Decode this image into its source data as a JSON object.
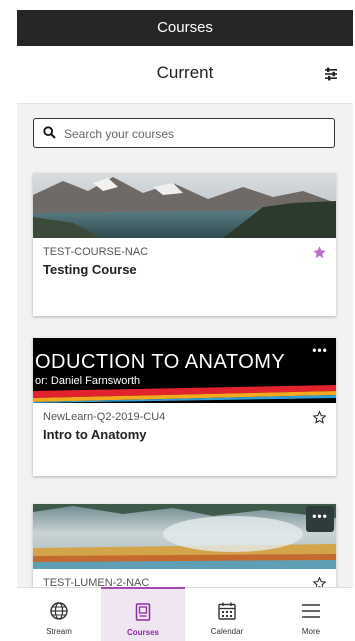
{
  "header": {
    "title": "Courses"
  },
  "subheader": {
    "title": "Current"
  },
  "search": {
    "placeholder": "Search your courses"
  },
  "courses": [
    {
      "id": "TEST-COURSE-NAC",
      "name": "Testing Course",
      "favorite": true
    },
    {
      "id": "NewLearn-Q2-2019-CU4",
      "name": "Intro to Anatomy",
      "favorite": false,
      "banner_title": "ODUCTION TO ANATOMY",
      "banner_subtitle": "or: Daniel Farnsworth"
    },
    {
      "id": "TEST-LUMEN-2-NAC",
      "name": "",
      "favorite": false
    }
  ],
  "more_label": "•••",
  "tabs": [
    {
      "label": "Stream",
      "icon": "globe-icon",
      "active": false
    },
    {
      "label": "Courses",
      "icon": "courses-icon",
      "active": true
    },
    {
      "label": "Calendar",
      "icon": "calendar-icon",
      "active": false
    },
    {
      "label": "More",
      "icon": "hamburger-icon",
      "active": false
    }
  ],
  "colors": {
    "accent": "#a24bb3",
    "topbar": "#262626",
    "favorite_star": "#b56fc4"
  }
}
